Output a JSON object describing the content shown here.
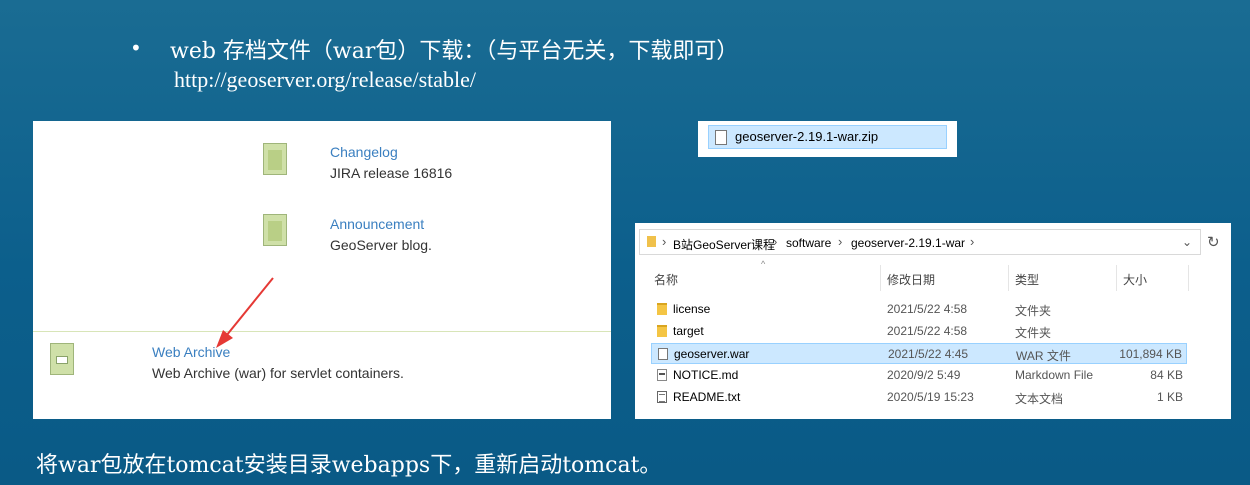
{
  "slide": {
    "bullet": "•",
    "line1": "web 存档文件（war包）下载：（与平台无关，下载即可）",
    "line2": "http://geoserver.org/release/stable/",
    "bottom": "将war包放在tomcat安装目录webapps下，重新启动tomcat。"
  },
  "release_page": {
    "items": [
      {
        "link": "Changelog",
        "desc": "JIRA release 16816"
      },
      {
        "link": "Announcement",
        "desc": "GeoServer blog."
      },
      {
        "link": "Web Archive",
        "desc": "Web Archive (war) for servlet containers."
      }
    ]
  },
  "download_item": {
    "name": "geoserver-2.19.1-war.zip"
  },
  "explorer": {
    "breadcrumb": [
      "B站GeoServer课程",
      "software",
      "geoserver-2.19.1-war"
    ],
    "breadcrumb_sep": "›",
    "dropdown": "⌄",
    "refresh": "↻",
    "sort_caret": "^",
    "columns": {
      "name": "名称",
      "date": "修改日期",
      "type": "类型",
      "size": "大小"
    },
    "files": [
      {
        "name": "license",
        "date": "2021/5/22 4:58",
        "type": "文件夹",
        "size": "",
        "icon": "folder-icon"
      },
      {
        "name": "target",
        "date": "2021/5/22 4:58",
        "type": "文件夹",
        "size": "",
        "icon": "folder-icon"
      },
      {
        "name": "geoserver.war",
        "date": "2021/5/22 4:45",
        "type": "WAR 文件",
        "size": "101,894 KB",
        "icon": "war-file-icon",
        "selected": true
      },
      {
        "name": "NOTICE.md",
        "date": "2020/9/2 5:49",
        "type": "Markdown File",
        "size": "84 KB",
        "icon": "markdown-file-icon"
      },
      {
        "name": "README.txt",
        "date": "2020/5/19 15:23",
        "type": "文本文档",
        "size": "1 KB",
        "icon": "text-file-icon"
      }
    ]
  },
  "colors": {
    "slide_bg": "#0c5f8c",
    "link": "#3a7fc0",
    "arrow": "#e53935",
    "selection": "#cce8ff"
  }
}
